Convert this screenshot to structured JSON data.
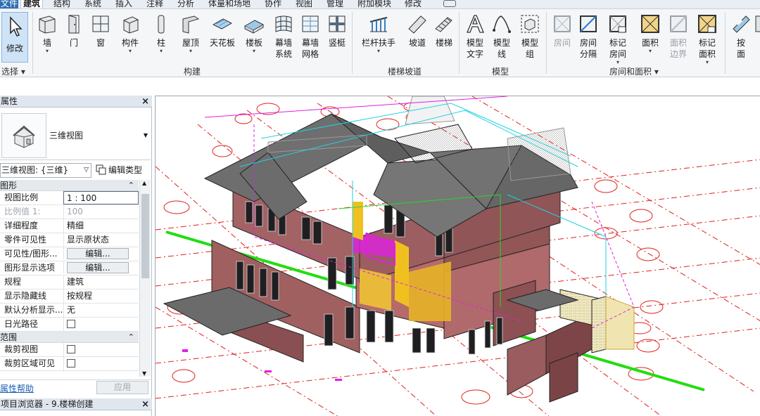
{
  "tabs": [
    "文件",
    "建筑",
    "结构",
    "系统",
    "插入",
    "注释",
    "分析",
    "体量和场地",
    "协作",
    "视图",
    "管理",
    "附加模块",
    "修改"
  ],
  "ribbon": {
    "modify": "修改",
    "select_group": "选择",
    "buttons": {
      "wall": "墙",
      "door": "门",
      "window": "窗",
      "component": "构件",
      "column": "柱",
      "roof": "屋顶",
      "ceiling": "天花板",
      "floor": "楼板",
      "curtain_system_1": "幕墙",
      "curtain_system_2": "系统",
      "curtain_grid_1": "幕墙",
      "curtain_grid_2": "网格",
      "mullion": "竖梃",
      "railing": "栏杆扶手",
      "ramp": "坡道",
      "stair": "楼梯",
      "model_text_1": "模型",
      "model_text_2": "文字",
      "model_line_1": "模型",
      "model_line_2": "线",
      "model_group_1": "模型",
      "model_group_2": "组",
      "room": "房间",
      "room_sep_1": "房间",
      "room_sep_2": "分隔",
      "tag_room_1": "标记",
      "tag_room_2": "房间",
      "area": "面积",
      "area_boundary_1": "面积",
      "area_boundary_2": "边界",
      "tag_area_1": "标记",
      "tag_area_2": "面积",
      "by_face_1": "按",
      "by_face_2": "面"
    },
    "panels": {
      "build": "构建",
      "circulation": "楼梯坡道",
      "model": "模型",
      "room_area": "房间和面积"
    }
  },
  "properties": {
    "title": "属性",
    "type_name": "三维视图",
    "instance_selector": "三维视图: {三维}",
    "edit_type": "编辑类型",
    "groups": {
      "graphics": "图形",
      "extents": "范围"
    },
    "rows": [
      {
        "key": "视图比例",
        "value": "1 : 100"
      },
      {
        "key": "比例值 1:",
        "value": "100"
      },
      {
        "key": "详细程度",
        "value": "精细"
      },
      {
        "key": "零件可见性",
        "value": "显示原状态"
      },
      {
        "key": "可见性/图形...",
        "value": "编辑..."
      },
      {
        "key": "图形显示选项",
        "value": "编辑..."
      },
      {
        "key": "规程",
        "value": "建筑"
      },
      {
        "key": "显示隐藏线",
        "value": "按规程"
      },
      {
        "key": "默认分析显示...",
        "value": "无"
      },
      {
        "key": "日光路径",
        "value": ""
      }
    ],
    "extent_rows": [
      {
        "key": "裁剪视图",
        "value": ""
      },
      {
        "key": "裁剪区域可见",
        "value": ""
      }
    ],
    "help": "属性帮助",
    "apply": "应用"
  },
  "browser": {
    "title": "项目浏览器 - 9.楼梯创建"
  },
  "colors": {
    "accent": "#2f6fb5",
    "ribbon_bg": "#f5f6f8",
    "pane_header": "#dfe6ee",
    "wall": "#9a5c5e",
    "roof": "#707070",
    "grid_red": "#e0201c",
    "green_line": "#22dd11",
    "magenta": "#e020e0"
  }
}
